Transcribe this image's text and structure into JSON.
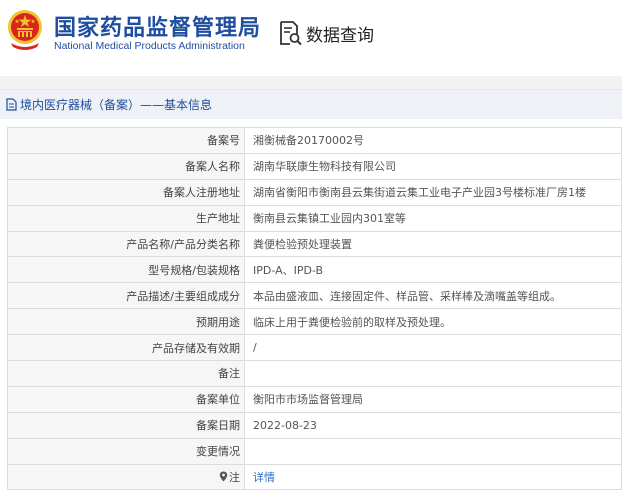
{
  "header": {
    "org_name_cn": "国家药品监督管理局",
    "org_name_en": "National Medical Products Administration",
    "emblem_icon": "national-emblem-icon",
    "query_icon": "document-search-icon",
    "query_title": "数据查询"
  },
  "breadcrumb": {
    "icon": "document-icon",
    "text": "境内医疗器械（备案）——基本信息"
  },
  "colors": {
    "brand_blue": "#1f4ea0",
    "emblem_red": "#d9261c",
    "emblem_gold": "#f2c230",
    "link_blue": "#2a6cc0"
  },
  "rows": [
    {
      "label": "备案号",
      "value": "湘衡械备20170002号"
    },
    {
      "label": "备案人名称",
      "value": "湖南华联康生物科技有限公司"
    },
    {
      "label": "备案人注册地址",
      "value": "湖南省衡阳市衡南县云集街道云集工业电子产业园3号楼标准厂房1楼"
    },
    {
      "label": "生产地址",
      "value": "衡南县云集镇工业园内301室等"
    },
    {
      "label": "产品名称/产品分类名称",
      "value": "粪便检验预处理装置"
    },
    {
      "label": "型号规格/包装规格",
      "value": "IPD-A、IPD-B"
    },
    {
      "label": "产品描述/主要组成成分",
      "value": "本品由盛液皿、连接固定件、样品管、采样棒及滴嘴盖等组成。"
    },
    {
      "label": "预期用途",
      "value": "临床上用于粪便检验前的取样及预处理。"
    },
    {
      "label": "产品存储及有效期",
      "value": "/"
    },
    {
      "label": "备注",
      "value": ""
    },
    {
      "label": "备案单位",
      "value": "衡阳市市场监督管理局"
    },
    {
      "label": "备案日期",
      "value": "2022-08-23"
    },
    {
      "label": "变更情况",
      "value": ""
    },
    {
      "label": "注",
      "value": "详情",
      "icon": "location-pin-icon"
    }
  ]
}
